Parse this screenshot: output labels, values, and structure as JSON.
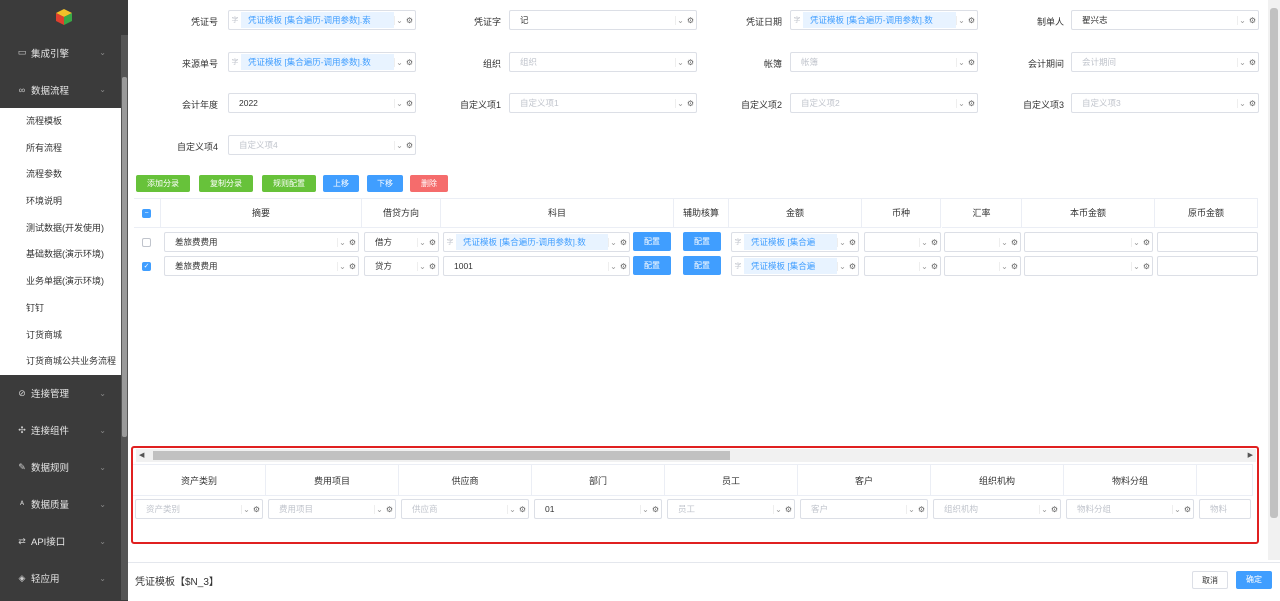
{
  "sidebar": {
    "groups_top": [
      {
        "label": "集成引擎",
        "icon": "monitor-icon"
      },
      {
        "label": "数据流程",
        "icon": "infinity-icon"
      }
    ],
    "sub_items": [
      "流程模板",
      "所有流程",
      "流程参数",
      "环境说明",
      "测试数据(开发使用)",
      "基础数据(演示环境)",
      "业务单据(演示环境)",
      "钉钉",
      "订货商城",
      "订货商城公共业务流程"
    ],
    "groups_bottom": [
      {
        "label": "连接管理",
        "icon": "link-icon"
      },
      {
        "label": "连接组件",
        "icon": "puzzle-icon"
      },
      {
        "label": "数据规则",
        "icon": "pen-icon"
      },
      {
        "label": "数据质量",
        "icon": "quality-icon"
      },
      {
        "label": "API接口",
        "icon": "swap-icon"
      },
      {
        "label": "轻应用",
        "icon": "cube-icon"
      }
    ]
  },
  "form": {
    "row1": [
      {
        "label": "凭证号",
        "type": "tag",
        "value": "凭证模板 [集合遍历-调用参数].索"
      },
      {
        "label": "凭证字",
        "type": "value",
        "value": "记"
      },
      {
        "label": "凭证日期",
        "type": "tag",
        "value": "凭证模板 [集合遍历-调用参数].数"
      },
      {
        "label": "制单人",
        "type": "value",
        "value": "翟兴志"
      }
    ],
    "row2": [
      {
        "label": "来源单号",
        "type": "tag",
        "value": "凭证模板 [集合遍历-调用参数].数"
      },
      {
        "label": "组织",
        "type": "ph",
        "value": "组织"
      },
      {
        "label": "帐簿",
        "type": "ph",
        "value": "帐簿"
      },
      {
        "label": "会计期间",
        "type": "ph",
        "value": "会计期间"
      }
    ],
    "row3": [
      {
        "label": "会计年度",
        "type": "value",
        "value": "2022"
      },
      {
        "label": "自定义项1",
        "type": "ph",
        "value": "自定义项1"
      },
      {
        "label": "自定义项2",
        "type": "ph",
        "value": "自定义项2"
      },
      {
        "label": "自定义项3",
        "type": "ph",
        "value": "自定义项3"
      }
    ],
    "row4": [
      {
        "label": "自定义项4",
        "type": "ph",
        "value": "自定义项4"
      }
    ]
  },
  "toolbar": {
    "add": "添加分录",
    "copy": "复制分录",
    "rule": "规则配置",
    "up": "上移",
    "down": "下移",
    "delete": "删除"
  },
  "grid": {
    "headers": [
      "摘要",
      "借贷方向",
      "科目",
      "辅助核算",
      "金额",
      "币种",
      "汇率",
      "本币金额",
      "原币金额"
    ],
    "rows": [
      {
        "checked": false,
        "summary": "差旅费费用",
        "direction": "借方",
        "subject_tag": "凭证模板 [集合遍历-调用参数].数",
        "config": "配置",
        "aux": "配置",
        "amount_tag": "凭证模板 [集合遍"
      },
      {
        "checked": true,
        "summary": "差旅费费用",
        "direction": "贷方",
        "subject_value": "1001",
        "config": "配置",
        "aux": "配置",
        "amount_tag": "凭证模板 [集合遍"
      }
    ],
    "zi": "字"
  },
  "aux_panel": {
    "headers": [
      "资产类别",
      "费用项目",
      "供应商",
      "部门",
      "员工",
      "客户",
      "组织机构",
      "物料分组"
    ],
    "fields": [
      {
        "type": "ph",
        "value": "资产类别"
      },
      {
        "type": "ph",
        "value": "费用项目"
      },
      {
        "type": "ph",
        "value": "供应商"
      },
      {
        "type": "value",
        "value": "01"
      },
      {
        "type": "ph",
        "value": "员工"
      },
      {
        "type": "ph",
        "value": "客户"
      },
      {
        "type": "ph",
        "value": "组织机构"
      },
      {
        "type": "ph",
        "value": "物料分组"
      },
      {
        "type": "ph",
        "value": "物料"
      }
    ]
  },
  "footer": {
    "title": "凭证模板【$N_3】",
    "cancel": "取消",
    "ok": "确定"
  },
  "colors": {
    "primary": "#409eff",
    "success": "#67c23a",
    "danger": "#f56c6c",
    "highlight_border": "#e02020",
    "sidebar_bg": "#3b3b3b"
  }
}
